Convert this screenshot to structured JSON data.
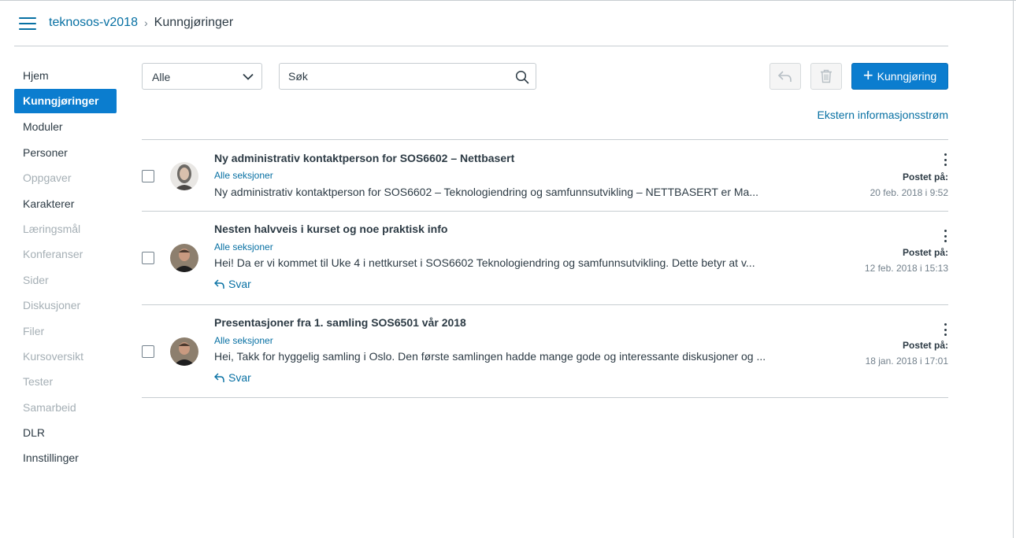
{
  "header": {
    "course_link": "teknosos-v2018",
    "separator": "›",
    "current_page": "Kunngjøringer"
  },
  "nav": [
    {
      "label": "Hjem",
      "state": "normal"
    },
    {
      "label": "Kunngjøringer",
      "state": "active"
    },
    {
      "label": "Moduler",
      "state": "normal"
    },
    {
      "label": "Personer",
      "state": "normal"
    },
    {
      "label": "Oppgaver",
      "state": "disabled"
    },
    {
      "label": "Karakterer",
      "state": "normal"
    },
    {
      "label": "Læringsmål",
      "state": "disabled"
    },
    {
      "label": "Konferanser",
      "state": "disabled"
    },
    {
      "label": "Sider",
      "state": "disabled"
    },
    {
      "label": "Diskusjoner",
      "state": "disabled"
    },
    {
      "label": "Filer",
      "state": "disabled"
    },
    {
      "label": "Kursoversikt",
      "state": "disabled"
    },
    {
      "label": "Tester",
      "state": "disabled"
    },
    {
      "label": "Samarbeid",
      "state": "disabled"
    },
    {
      "label": "DLR",
      "state": "normal"
    },
    {
      "label": "Innstillinger",
      "state": "normal"
    }
  ],
  "toolbar": {
    "filter_value": "Alle",
    "search_placeholder": "Søk",
    "mark_read_icon": "reply-arrow-icon",
    "delete_icon": "trash-icon",
    "add_button_label": "Kunngjøring",
    "external_feed_link": "Ekstern informasjonsstrøm"
  },
  "announcements": [
    {
      "title": "Ny administrativ kontaktperson for SOS6602 – Nettbasert",
      "sections": "Alle seksjoner",
      "excerpt": "Ny administrativ kontaktperson for SOS6602 – Teknologiendring og samfunnsutvikling – NETTBASERT er Ma...",
      "has_reply": false,
      "posted_label": "Postet på:",
      "posted_date": "20 feb. 2018 i 9:52"
    },
    {
      "title": "Nesten halvveis i kurset og noe praktisk info",
      "sections": "Alle seksjoner",
      "excerpt": "Hei! Da er vi kommet til Uke 4 i nettkurset i SOS6602 Teknologiendring og samfunnsutvikling. Dette betyr at v...",
      "has_reply": true,
      "reply_label": "Svar",
      "posted_label": "Postet på:",
      "posted_date": "12 feb. 2018 i 15:13"
    },
    {
      "title": "Presentasjoner fra 1. samling SOS6501 vår 2018",
      "sections": "Alle seksjoner",
      "excerpt": "Hei,  Takk for hyggelig samling i Oslo. Den første samlingen hadde mange gode og interessante diskusjoner og ...",
      "has_reply": true,
      "reply_label": "Svar",
      "posted_label": "Postet på:",
      "posted_date": "18 jan. 2018 i 17:01"
    }
  ],
  "colors": {
    "accent": "#0b7dcf",
    "link": "#0770a3",
    "text": "#2d3b45",
    "muted": "#a5afb5",
    "border": "#c7cdd1"
  }
}
